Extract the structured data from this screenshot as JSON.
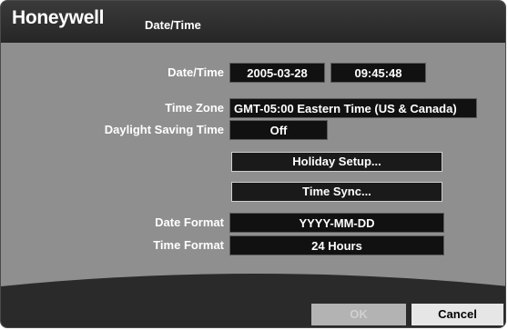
{
  "header": {
    "brand": "Honeywell",
    "title": "Date/Time"
  },
  "form": {
    "date_time": {
      "label": "Date/Time",
      "date": "2005-03-28",
      "time": "09:45:48"
    },
    "time_zone": {
      "label": "Time Zone",
      "value": "GMT-05:00  Eastern Time (US & Canada)"
    },
    "dst": {
      "label": "Daylight Saving Time",
      "value": "Off"
    },
    "holiday_setup_label": "Holiday Setup...",
    "time_sync_label": "Time Sync...",
    "date_format": {
      "label": "Date Format",
      "value": "YYYY-MM-DD"
    },
    "time_format": {
      "label": "Time Format",
      "value": "24 Hours"
    }
  },
  "footer": {
    "ok_label": "OK",
    "cancel_label": "Cancel"
  },
  "colors": {
    "panel": "#8f8f8f",
    "titlebar": "#262626",
    "field": "#111111",
    "text": "#ffffff"
  }
}
